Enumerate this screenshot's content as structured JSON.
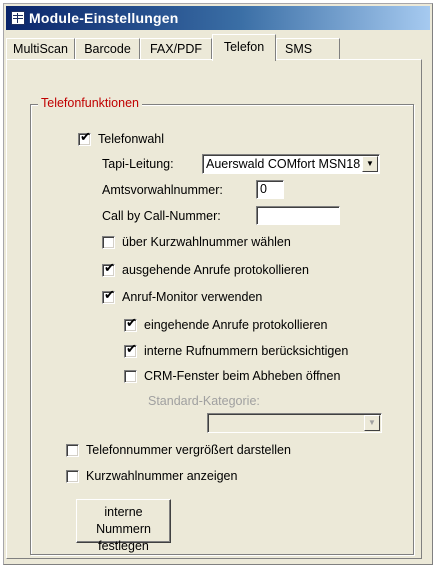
{
  "window": {
    "title": "Module-Einstellungen"
  },
  "tabs": [
    {
      "label": "MultiScan"
    },
    {
      "label": "Barcode"
    },
    {
      "label": "FAX/PDF"
    },
    {
      "label": "Telefon",
      "active": true
    },
    {
      "label": "SMS"
    }
  ],
  "group": {
    "label": "Telefonfunktionen",
    "telefonwahl": {
      "label": "Telefonwahl",
      "checked": true
    },
    "tapi": {
      "label": "Tapi-Leitung:",
      "value": "Auerswald COMfort MSN18"
    },
    "amtsvorwahl": {
      "label": "Amtsvorwahlnummer:",
      "value": "0"
    },
    "callby": {
      "label": "Call by Call-Nummer:",
      "value": ""
    },
    "kurzwahl_waehlen": {
      "label": "über Kurzwahlnummer wählen",
      "checked": false
    },
    "ausgehende": {
      "label": "ausgehende Anrufe protokollieren",
      "checked": true
    },
    "anrufmonitor": {
      "label": "Anruf-Monitor verwenden",
      "checked": true
    },
    "eingehende": {
      "label": "eingehende Anrufe protokollieren",
      "checked": true
    },
    "interne_rufnummern": {
      "label": "interne Rufnummern berücksichtigen",
      "checked": true
    },
    "crm_fenster": {
      "label": "CRM-Fenster beim Abheben öffnen",
      "checked": false
    },
    "standard_kategorie": {
      "label": "Standard-Kategorie:",
      "value": ""
    },
    "telefonnummer_gross": {
      "label": "Telefonnummer vergrößert darstellen",
      "checked": false
    },
    "kurzwahl_anzeigen": {
      "label": "Kurzwahlnummer anzeigen",
      "checked": false
    },
    "interne_button": {
      "line1": "interne Nummern",
      "line2": "festlegen"
    }
  },
  "icons": {
    "checkmark": "✔",
    "dropdown": "▼"
  }
}
